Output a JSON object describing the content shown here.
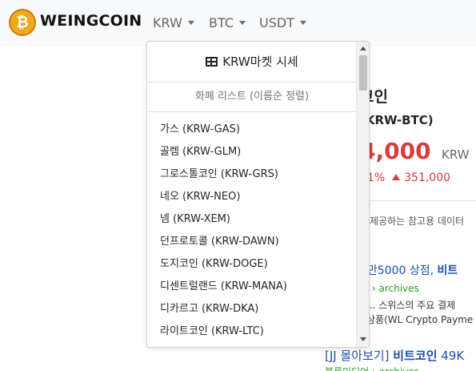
{
  "brand": {
    "name": "WEINGCOIN",
    "logo_icon": "bitcoin-logo-icon",
    "logo_glyph": "₿",
    "logo_color": "#f0a81c"
  },
  "nav": {
    "items": [
      {
        "label": "KRW"
      },
      {
        "label": "BTC"
      },
      {
        "label": "USDT"
      }
    ]
  },
  "dropdown": {
    "header": "KRW마켓 시세",
    "header_icon": "table-icon",
    "subheader": "화폐 리스트 (이름순 정렬)",
    "items": [
      "가스 (KRW-GAS)",
      "골렘 (KRW-GLM)",
      "그로스톨코인 (KRW-GRS)",
      "네오 (KRW-NEO)",
      "넴 (KRW-XEM)",
      "던프로토콜 (KRW-DAWN)",
      "도지코인 (KRW-DOGE)",
      "디센트럴랜드 (KRW-MANA)",
      "디카르고 (KRW-DKA)",
      "라이트코인 (KRW-LTC)"
    ]
  },
  "coin": {
    "name_partial": "코인",
    "code_partial": "(KRW-BTC)",
    "price_partial": "4,000",
    "unit": "KRW",
    "change_pct_partial": "61%",
    "change_amount": "351,000",
    "up_color": "#d93a3a"
  },
  "reference_text": "제공하는 참고용 데이터",
  "news": [
    {
      "title_prefix": "3만5000 상점, ",
      "title_bold": "비트",
      "source": "거 › archives",
      "snippet1": "... 스위스의 주요 결제",
      "snippet2": "상품(WL Crypto Payme"
    },
    {
      "title_prefix": "[JJ 몰아보기] ",
      "title_bold": "비트코인",
      "title_suffix": " 49K",
      "source": "블록미디어 › archives"
    }
  ]
}
